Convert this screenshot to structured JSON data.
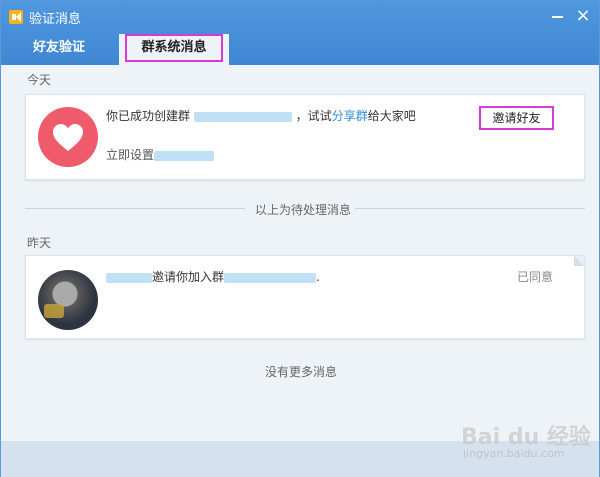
{
  "window": {
    "title": "验证消息"
  },
  "tabs": [
    {
      "label": "好友验证"
    },
    {
      "label": "群系统消息"
    }
  ],
  "today": {
    "label": "今天",
    "msg_prefix": "你已成功创建群",
    "msg_mid": "，试试",
    "msg_link": "分享群",
    "msg_suffix": "给大家吧",
    "invite_button": "邀请好友",
    "setup_prefix": "立即设置"
  },
  "divider_text": "以上为待处理消息",
  "yesterday": {
    "label": "昨天",
    "msg_mid": "邀请你加入群",
    "msg_end": ".",
    "status": "已同意"
  },
  "no_more": "没有更多消息",
  "watermark": {
    "brand": "Bai du 经验",
    "url": "jingyan.baidu.com"
  },
  "colors": {
    "titlebar": "#4a92dc",
    "accent_link": "#2a8de0",
    "heart_avatar": "#ef5b6b",
    "highlight_box": "#d83ad8"
  }
}
